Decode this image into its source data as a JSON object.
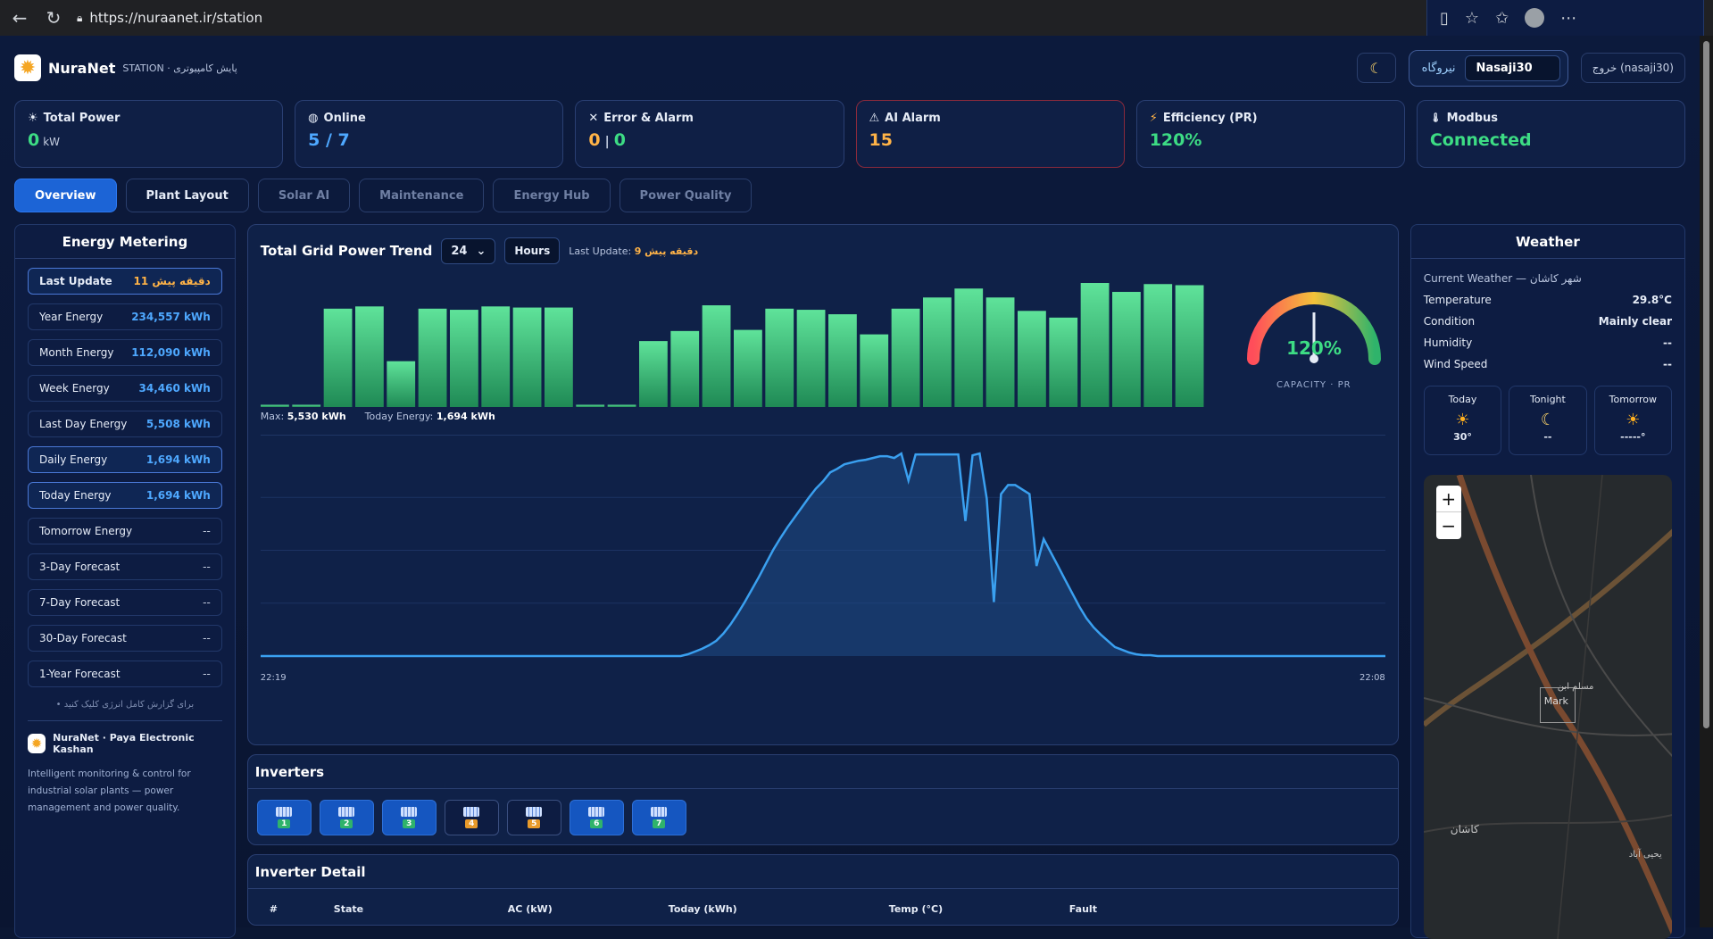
{
  "browser": {
    "url": "https://nuraanet.ir/station"
  },
  "header": {
    "brand": "NuraNet",
    "subtitle": "STATION · پایش کامپیوتری",
    "station_label": "نیروگاه",
    "station_value": "Nasaji30",
    "logout": "خروج (nasaji30)"
  },
  "stats": [
    {
      "icon": "☀",
      "title": "Total Power",
      "value": "0",
      "unit": "kW",
      "color": "#3ddc84"
    },
    {
      "icon": "◍",
      "title": "Online",
      "value": "5 / 7",
      "color": "#4ea8ff"
    },
    {
      "icon": "✕",
      "title": "Error & Alarm",
      "value_a": "0",
      "value_b": "0"
    },
    {
      "icon": "⚠",
      "title": "AI Alarm",
      "value": "15",
      "color": "#ffb347"
    },
    {
      "icon": "⚡",
      "title": "Efficiency (PR)",
      "value": "120%",
      "color": "#3ddc84"
    },
    {
      "icon": "🌡",
      "title": "Modbus",
      "value": "Connected",
      "color": "#3ddc84"
    }
  ],
  "tabs": [
    "Overview",
    "Plant Layout",
    "Solar AI",
    "Maintenance",
    "Energy Hub",
    "Power Quality"
  ],
  "metering": {
    "title": "Energy Metering",
    "last_update_label": "Last Update",
    "last_update_value": "11 دقیقه پیش",
    "rows": [
      {
        "k": "Year Energy",
        "v": "234,557 kWh"
      },
      {
        "k": "Month Energy",
        "v": "112,090 kWh"
      },
      {
        "k": "Week Energy",
        "v": "34,460 kWh"
      },
      {
        "k": "Last Day Energy",
        "v": "5,508 kWh"
      },
      {
        "k": "Daily Energy",
        "v": "1,694 kWh"
      },
      {
        "k": "Today Energy",
        "v": "1,694 kWh"
      },
      {
        "k": "Tomorrow Energy",
        "v": "--"
      },
      {
        "k": "3-Day Forecast",
        "v": "--"
      },
      {
        "k": "7-Day Forecast",
        "v": "--"
      },
      {
        "k": "30-Day Forecast",
        "v": "--"
      },
      {
        "k": "1-Year Forecast",
        "v": "--"
      }
    ],
    "hint": "• برای گزارش کامل انرژی کلیک کنید",
    "about_title": "NuraNet · Paya Electronic Kashan",
    "about_text": "Intelligent monitoring & control for industrial solar plants — power management and power quality."
  },
  "trend": {
    "title": "Total Grid Power Trend",
    "range": "24",
    "unit_btn": "Hours",
    "last_update_label": "Last Update:",
    "last_update_value": "9 دقیقه پیش",
    "max_label": "Max:",
    "max_value": "5,530 kWh",
    "today_label": "Today Energy:",
    "today_value": "1,694 kWh",
    "gauge_value": "120%",
    "gauge_caption": "CAPACITY · PR",
    "time_start": "22:19",
    "time_end": "22:08"
  },
  "chart_data": [
    {
      "type": "bar",
      "title": "",
      "values": [
        2,
        2,
        88,
        90,
        41,
        88,
        87,
        90,
        89,
        89,
        2,
        2,
        59,
        68,
        91,
        69,
        88,
        87,
        83,
        65,
        88,
        98,
        106,
        98,
        86,
        80,
        111,
        103,
        110,
        109
      ],
      "ylim": [
        0,
        115
      ]
    },
    {
      "type": "line",
      "title": "",
      "values": [
        0,
        0,
        0,
        0,
        0,
        0,
        0,
        0,
        0,
        0,
        0,
        0,
        0,
        0,
        0,
        0,
        0,
        0,
        0,
        0,
        0,
        0,
        0,
        0,
        0,
        0,
        0,
        0,
        0,
        0,
        0,
        0,
        0,
        0,
        0,
        0,
        0,
        0,
        0,
        0,
        0,
        0,
        0,
        0,
        0,
        0,
        0,
        0,
        0,
        0,
        0,
        0,
        0,
        0,
        0,
        0,
        0,
        0,
        0,
        0,
        2,
        5,
        8,
        12,
        17,
        25,
        35,
        47,
        60,
        74,
        88,
        103,
        118,
        131,
        143,
        154,
        165,
        176,
        186,
        194,
        204,
        208,
        213,
        215,
        217,
        218,
        220,
        222,
        222,
        220,
        225,
        195,
        224,
        224,
        224,
        224,
        224,
        224,
        224,
        150,
        223,
        225,
        175,
        60,
        180,
        190,
        190,
        185,
        180,
        100,
        130,
        115,
        100,
        85,
        70,
        55,
        42,
        32,
        24,
        17,
        10,
        7,
        4,
        2,
        1,
        1,
        0,
        0,
        0,
        0,
        0,
        0,
        0,
        0,
        0,
        0,
        0,
        0,
        0,
        0,
        0,
        0,
        0,
        0,
        0,
        0,
        0,
        0,
        0,
        0,
        0,
        0,
        0,
        0,
        0,
        0,
        0,
        0,
        0
      ],
      "ylim": [
        0,
        235
      ]
    }
  ],
  "inverters": {
    "title": "Inverters",
    "items": [
      {
        "n": "1",
        "state": "on",
        "badge": "g"
      },
      {
        "n": "2",
        "state": "on",
        "badge": "g"
      },
      {
        "n": "3",
        "state": "on",
        "badge": "g"
      },
      {
        "n": "4",
        "state": "off",
        "badge": "o"
      },
      {
        "n": "5",
        "state": "off",
        "badge": "o"
      },
      {
        "n": "6",
        "state": "on",
        "badge": "g"
      },
      {
        "n": "7",
        "state": "on",
        "badge": "g"
      }
    ]
  },
  "detail": {
    "title": "Inverter Detail",
    "columns": [
      "#",
      "State",
      "AC (kW)",
      "Today (kWh)",
      "Temp (°C)",
      "Fault"
    ]
  },
  "weather": {
    "title": "Weather",
    "current_label": "Current Weather — شهر کاشان",
    "rows": [
      {
        "k": "Temperature",
        "v": "29.8°C"
      },
      {
        "k": "Condition",
        "v": "Mainly clear"
      },
      {
        "k": "Humidity",
        "v": "--"
      },
      {
        "k": "Wind Speed",
        "v": "--"
      }
    ],
    "forecast": [
      {
        "label": "Today",
        "icon": "☀",
        "temp": "30°"
      },
      {
        "label": "Tonight",
        "icon": "☾",
        "temp": "--"
      },
      {
        "label": "Tomorrow",
        "icon": "☀",
        "temp": "-----°"
      }
    ]
  },
  "map": {
    "zoom_in": "+",
    "zoom_out": "−",
    "marker": "Mark",
    "labels": [
      "مسلم ابن",
      "کاشان",
      "یحیی آباد"
    ]
  }
}
